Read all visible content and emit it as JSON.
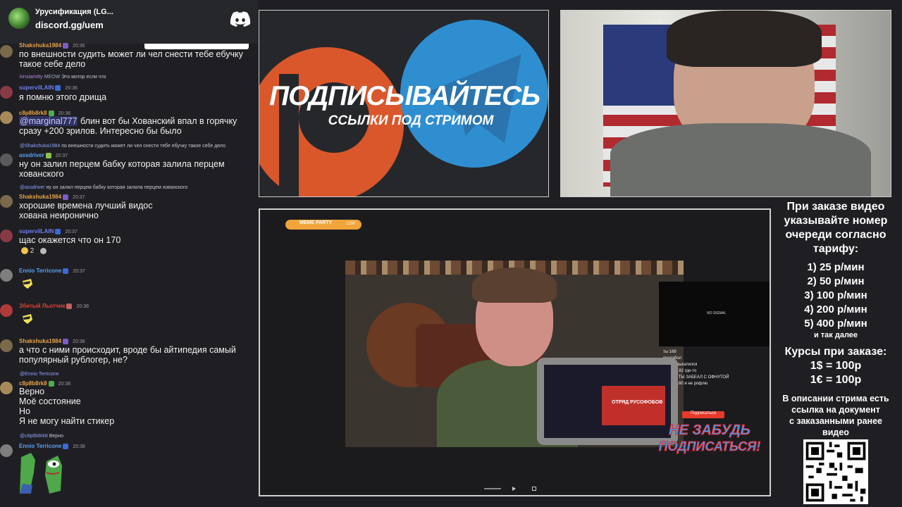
{
  "discord": {
    "server_name": "Урусификация (LG...",
    "invite": "discord.gg/uem"
  },
  "chat": {
    "messages": [
      {
        "user": "Shakshuka1984",
        "time": "20:36",
        "color": "#e6a445",
        "text": "по внешности судить может ли чел снести тебе ебучку такое себе дело"
      },
      {
        "reply_user": "kinsiamitty",
        "reply_badge": "MEOW",
        "reply_text": "Это мотор если что"
      },
      {
        "user": "supervilLAIN",
        "time": "20:36",
        "color": "#6f7ef0",
        "text": "я помню этого дрища"
      },
      {
        "user": "c8p8b8rk8",
        "time": "20:36",
        "color": "#e6a445",
        "mention": "@marginal777",
        "text": "блин вот бы Хованский впал в горячку сразу +200 зрилов. Интересно бы было"
      },
      {
        "reply_user": "@Shakshuka1984",
        "reply_text": "по внешности судить может ли чел снести тебе ебучку такое себе дело"
      },
      {
        "user": "assdriver",
        "time": "20:37",
        "color": "#5aa0f0",
        "text": "ну он залил перцем бабку которая залила перцем хованского"
      },
      {
        "reply_user": "@assdriver",
        "reply_text": "ну он залил перцем бабку которая залила перцем хованского"
      },
      {
        "user": "Shakshuka1984",
        "time": "20:37",
        "color": "#e6a445",
        "text": "хорошие времена лучший видос хована неиронично"
      },
      {
        "user": "supervilLAIN",
        "time": "20:37",
        "color": "#6f7ef0",
        "text": "щас окажется что он 170"
      },
      {
        "reaction_count": "2"
      },
      {
        "user": "Ennio Terricone",
        "time": "20:37",
        "color": "#5aa0f0"
      },
      {
        "user": "Збитый Льотчик",
        "time": "20:38",
        "color": "#e0423a"
      },
      {
        "user": "Shakshuka1984",
        "time": "20:38",
        "color": "#e6a445",
        "text": "а что с ними происходит, вроде бы айтипедия самый популярный рублогер, не?"
      },
      {
        "reply_user": "@Ennio Terricone",
        "reply_text": ""
      },
      {
        "user": "c8p8b8rk8",
        "time": "20:38",
        "color": "#e6a445",
        "lines": [
          "Верно",
          "Моё состояние",
          "Но",
          "Я не могу найти стикер"
        ]
      },
      {
        "reply_user": "@c8p8b8rk8",
        "reply_text": "Верно"
      },
      {
        "user": "Ennio Terricone",
        "time": "20:38",
        "color": "#5aa0f0"
      }
    ]
  },
  "promo": {
    "headline": "ПОДПИСЫВАЙТЕСЬ",
    "subline": "ССЫЛКИ ПОД СТРИМОМ"
  },
  "main_video": {
    "progress_label": "МЕМЕ PARTY",
    "progress_value": "1200",
    "no_signal": "NO SIGNAL",
    "subscribe_line1": "НЕ ЗАБУДЬ",
    "subscribe_line2": "ПОДПИСАТЬСЯ!",
    "subscribe_small": "Подписаться",
    "mini_chat": [
      "ты 169",
      "пиздабол",
      "Он бы выкатился",
      "Банан 192 где-то",
      "ead47_ ТЫ ЗАБЕАЛ С ОФНУТОЙ",
      "дедли 160 я не рофлю"
    ],
    "thumb_text": "ОТРЯД РУСОФОБОВ"
  },
  "info": {
    "order_text": [
      "При заказе видео",
      "указывайте номер",
      "очереди согласно",
      "тарифу:"
    ],
    "tariffs": [
      "1) 25 р/мин",
      "2) 50 р/мин",
      "3) 100 р/мин",
      "4) 200 р/мин",
      "5) 400 р/мин"
    ],
    "and_so_on": "и так далее",
    "courses_title": "Курсы при заказе:",
    "courses": [
      "1$ = 100р",
      "1€ = 100р"
    ],
    "description": [
      "В описании стрима есть",
      "ссылка на документ",
      "с заказанными ранее",
      "видео"
    ]
  }
}
